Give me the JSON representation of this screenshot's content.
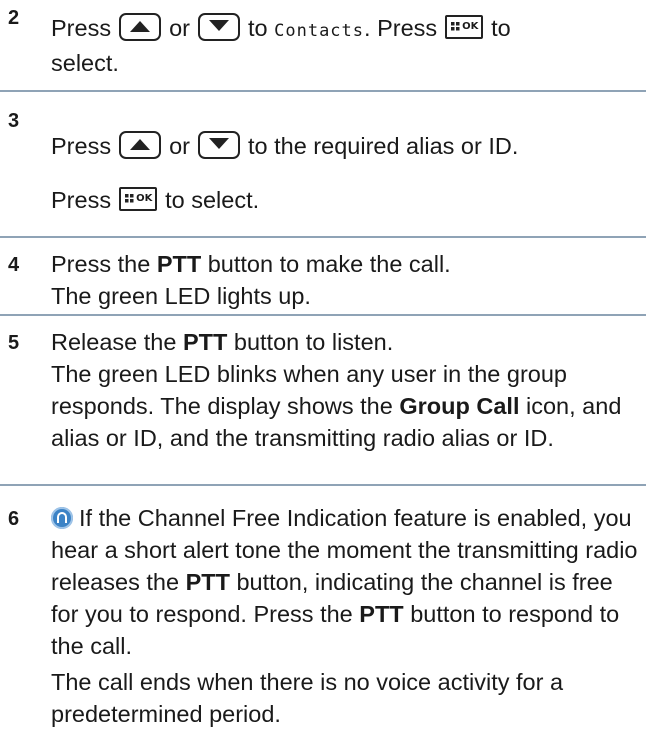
{
  "step2": {
    "number": "2",
    "press": "Press",
    "or": "or",
    "to": "to",
    "menu_item": "Contacts",
    "press2": ". Press",
    "select_text": "to",
    "select_end": "select."
  },
  "step3": {
    "number": "3",
    "press": "Press",
    "or": "or",
    "rest": "to the required alias or ID.",
    "press2": "Press",
    "select_text": "to select."
  },
  "step4": {
    "number": "4",
    "prefix": "Press the",
    "ptt": "PTT",
    "suffix": "button to make the call.",
    "line2": "The green LED lights up."
  },
  "step5": {
    "number": "5",
    "prefix": "Release the",
    "ptt": "PTT",
    "suffix": "button to listen.",
    "p2_a": "The green LED blinks when any user in the group responds. The display shows the",
    "group_call": "Group Call",
    "p2_b": "icon, and alias or ID, and the transmitting radio alias or ID."
  },
  "step6": {
    "number": "6",
    "p1_a": "If the Channel Free Indication feature is enabled, you hear a short alert tone the moment the transmitting radio releases the",
    "ptt": "PTT",
    "p1_b": "button, indicating the channel is free for you to respond. Press the",
    "ptt2": "PTT",
    "p1_c": "button to respond to the call.",
    "p2": "The call ends when there is no voice activity for a predetermined period."
  },
  "icons": {
    "up_key": "up-arrow-key-icon",
    "down_key": "down-arrow-key-icon",
    "ok_key": "menu-ok-key-icon",
    "info": "info-icon",
    "icon_color": "#3c83c6",
    "separator_color": "#8fa3b6"
  }
}
